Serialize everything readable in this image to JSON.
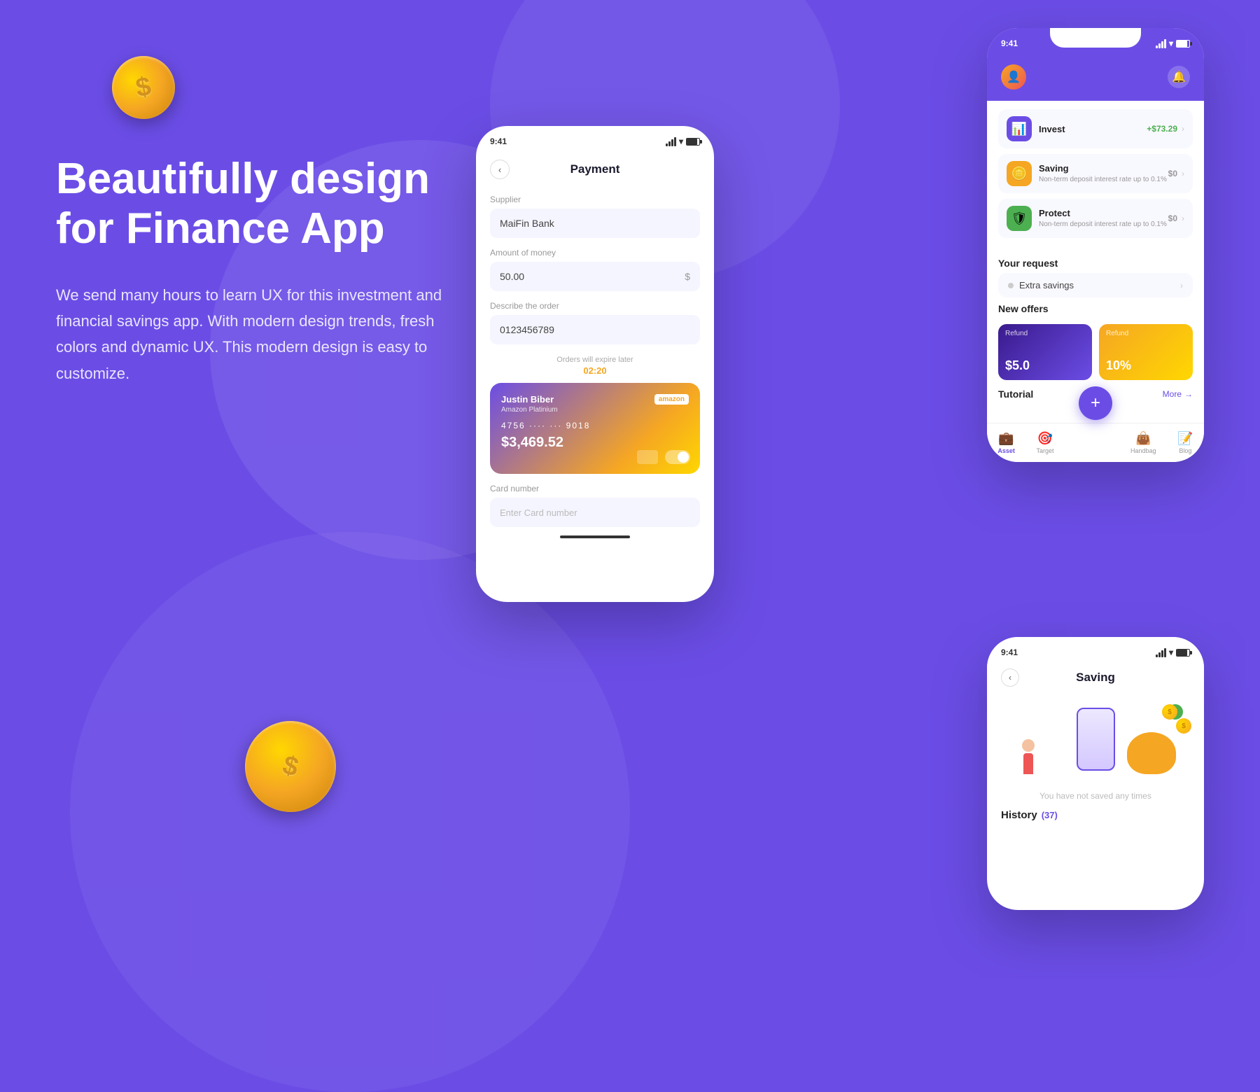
{
  "background": "#6B4DE6",
  "left": {
    "heading_line1": "Beautifully design",
    "heading_line2": "for Finance App",
    "description": "We send many hours to learn UX for this investment and financial savings app. With modern design trends, fresh colors and dynamic UX. This modern design is easy to customize."
  },
  "payment_phone": {
    "status_time": "9:41",
    "header_title": "Payment",
    "back_label": "<",
    "supplier_label": "Supplier",
    "supplier_value": "MaiFin Bank",
    "amount_label": "Amount of money",
    "amount_value": "50.00",
    "amount_suffix": "$",
    "describe_label": "Describe the order",
    "describe_value": "0123456789",
    "expire_text": "Orders will expire later",
    "expire_time": "02:20",
    "card_name": "Justin Biber",
    "card_amazon": "amazon",
    "card_type": "Amazon Platinium",
    "card_number": "4756  ····  ···  9018",
    "card_balance": "$3,469.52",
    "card_number_label": "Card number",
    "card_number_placeholder": "Enter Card number"
  },
  "dashboard_phone": {
    "status_time": "9:41",
    "invest_label": "Invest",
    "invest_amount": "+$73.29",
    "saving_label": "Saving",
    "saving_amount": "$0",
    "saving_desc": "Non-term deposit interest rate up to 0.1%",
    "protect_label": "Protect",
    "protect_amount": "$0",
    "protect_desc": "Non-term deposit interest rate up to 0.1%",
    "your_request_title": "Your request",
    "extra_savings_label": "Extra savings",
    "new_offers_title": "New offers",
    "offer1_label": "Refund",
    "offer1_amount": "$5.0",
    "offer2_label": "Refund",
    "offer2_amount": "10%",
    "tutorial_title": "Tutorial",
    "tutorial_more": "More",
    "nav_asset": "Asset",
    "nav_target": "Target",
    "nav_handbag": "Handbag",
    "nav_blog": "Blog"
  },
  "saving_phone": {
    "status_time": "9:41",
    "title": "Saving",
    "back_label": "<",
    "empty_text": "You have not saved any times",
    "history_label": "History",
    "history_count": "(37)"
  }
}
